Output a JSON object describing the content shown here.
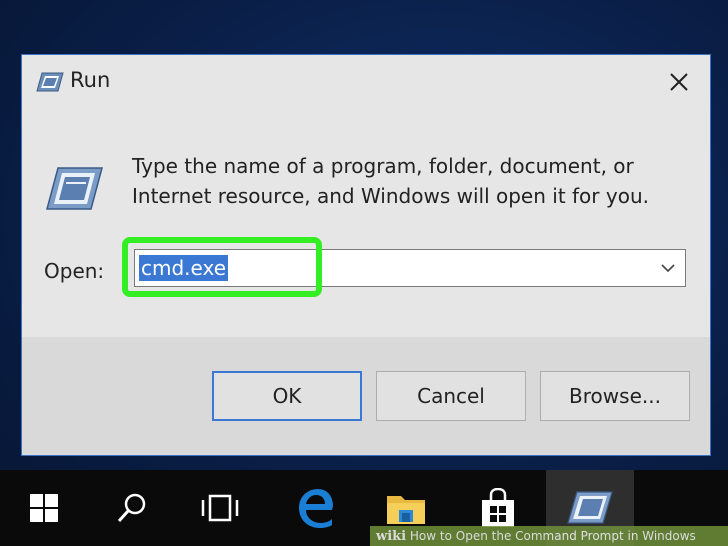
{
  "dialog": {
    "title": "Run",
    "description": "Type the name of a program, folder, document, or Internet resource, and Windows will open it for you.",
    "open_label": "Open:",
    "open_value": "cmd.exe",
    "buttons": {
      "ok": "OK",
      "cancel": "Cancel",
      "browse": "Browse..."
    }
  },
  "taskbar": {
    "items": [
      "start-icon",
      "search-icon",
      "task-view-icon",
      "edge-icon",
      "file-explorer-icon",
      "store-icon",
      "run-icon"
    ],
    "active": "run-icon"
  },
  "watermark": {
    "brand": "wiki",
    "text": "How to Open the Command Prompt in Windows"
  },
  "colors": {
    "highlight": "#33ee22",
    "selection": "#3a78d4",
    "dialog_border": "#3a72c5",
    "taskbar": "#0a0a0a"
  }
}
